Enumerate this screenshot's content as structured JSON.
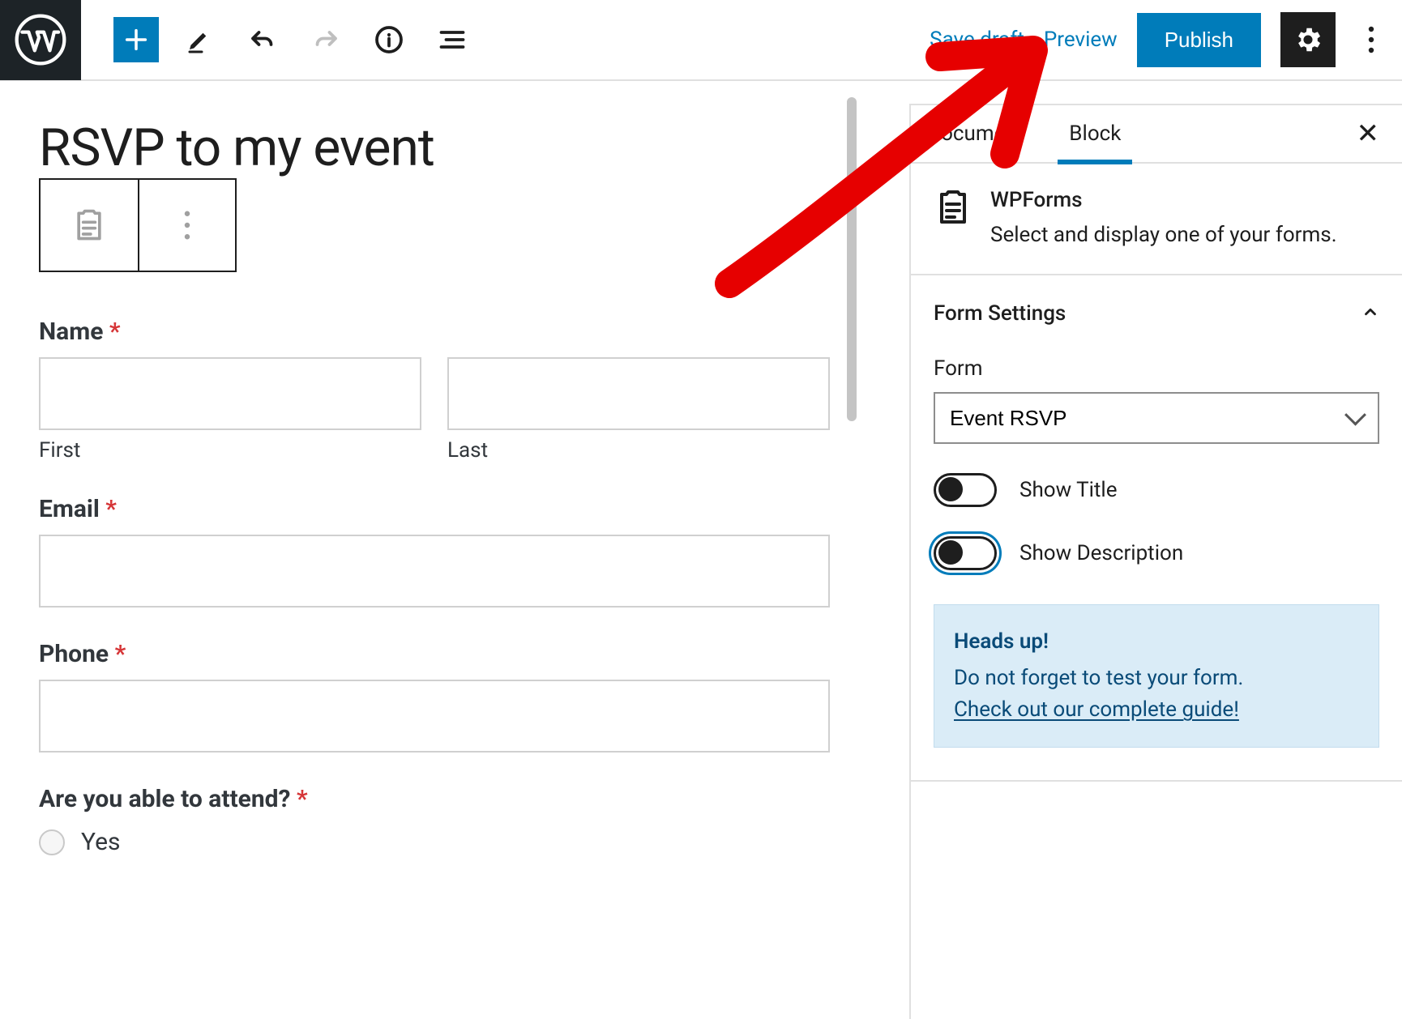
{
  "toolbar": {
    "save_draft": "Save draft",
    "preview": "Preview",
    "publish": "Publish"
  },
  "editor": {
    "title": "RSVP to my event",
    "form": {
      "name_label": "Name",
      "first_sublabel": "First",
      "last_sublabel": "Last",
      "email_label": "Email",
      "phone_label": "Phone",
      "attend_label": "Are you able to attend?",
      "attend_options": [
        "Yes"
      ]
    }
  },
  "sidebar": {
    "tabs": {
      "document": "Document",
      "block": "Block"
    },
    "block_header": {
      "title": "WPForms",
      "desc": "Select and display one of your forms."
    },
    "form_settings": {
      "panel_title": "Form Settings",
      "form_label": "Form",
      "form_selected": "Event RSVP",
      "show_title_label": "Show Title",
      "show_description_label": "Show Description"
    },
    "heads_up": {
      "title": "Heads up!",
      "text": "Do not forget to test your form.",
      "link": "Check out our complete guide!"
    }
  }
}
